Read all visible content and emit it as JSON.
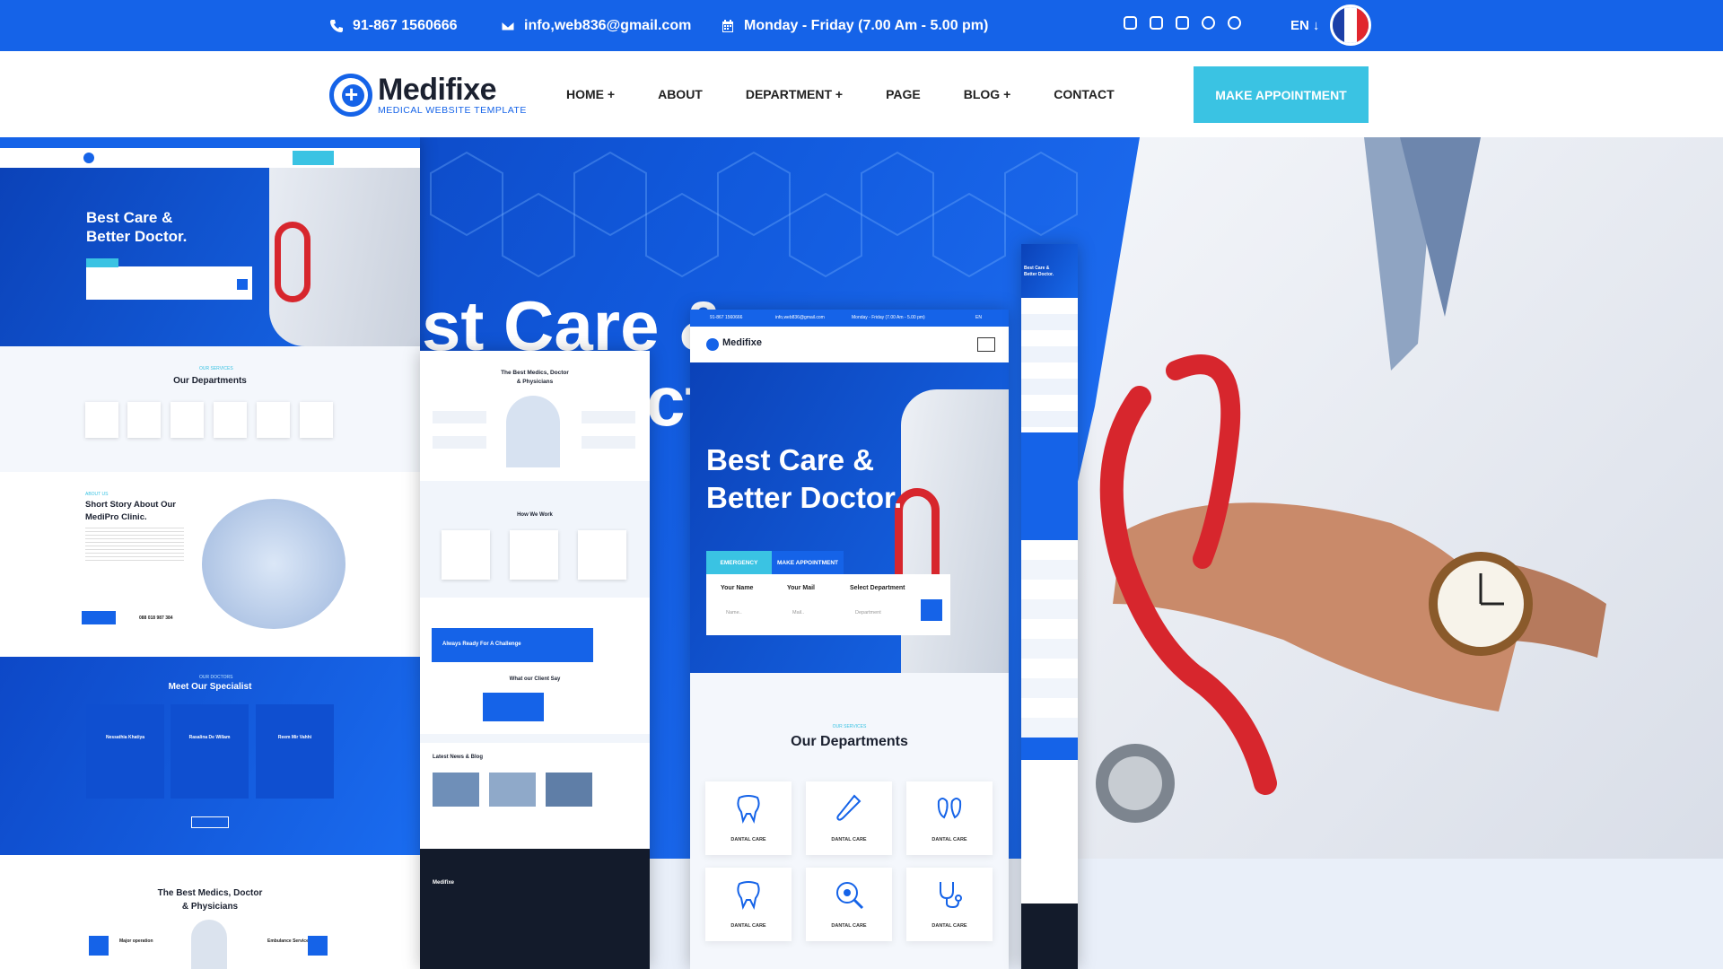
{
  "topbar": {
    "phone": "91-867 1560666",
    "email": "info,web836@gmail.com",
    "hours": "Monday - Friday (7.00 Am - 5.00 pm)",
    "social_icons": [
      "facebook-icon",
      "twitter-icon",
      "youtube-icon",
      "instagram-icon",
      "pinterest-icon"
    ],
    "language": "EN"
  },
  "brand": {
    "name": "Medifixe",
    "tagline": "MEDICAL WEBSITE TEMPLATE"
  },
  "nav": {
    "items": [
      "HOME +",
      "ABOUT",
      "DEPARTMENT +",
      "PAGE",
      "BLOG +",
      "CONTACT"
    ],
    "cta": "MAKE APPOINTMENT"
  },
  "hero": {
    "big_text_line1": "st Care &",
    "big_text_line2": "ct"
  },
  "mock_left": {
    "hero_title_1": "Best Care &",
    "hero_title_2": "Better Doctor.",
    "sub_label": "OUR SERVICES",
    "departments_title": "Our Departments",
    "about_label": "ABOUT US",
    "about_title_1": "Short Story About Our",
    "about_title_2": "MediPro Clinic.",
    "phone": "088 018 987 384",
    "specialist_label": "OUR DOCTORS",
    "specialist_title": "Meet Our Specialist",
    "doctors": [
      "Nessathia Khatiya",
      "Rasalina De Willam",
      "Reem Mir Vahhi"
    ],
    "medics_title_1": "The Best Medics, Doctor",
    "medics_title_2": "& Physicians",
    "medics_service_1": "Major operation",
    "medics_service_2": "Embulance Service"
  },
  "mock_mid": {
    "medics_title_1": "The Best Medics, Doctor",
    "medics_title_2": "& Physicians",
    "how_title": "How We Work",
    "banner": "Always Ready For A Challenge",
    "client_title": "What our Client Say",
    "news_title": "Latest News & Blog",
    "footer_brand": "Medifixe"
  },
  "mock_center": {
    "phone": "91-867 1560666",
    "email": "info,web836@gmail.com",
    "hours": "Monday - Friday (7.00 Am - 5.00 pm)",
    "lang": "EN",
    "brand": "Medifixe",
    "hero_title_1": "Best Care &",
    "hero_title_2": "Better Doctor.",
    "tab_emergency": "EMERGENCY",
    "tab_appointment": "MAKE APPOINTMENT",
    "form_name": "Your Name",
    "form_mail": "Your Mail",
    "form_dept": "Select Department",
    "ph_name": "Name..",
    "ph_mail": "Mail..",
    "ph_dept": "Department",
    "services_label": "OUR SERVICES",
    "departments_title": "Our Departments",
    "departments": [
      "DANTAL CARE",
      "DANTAL CARE",
      "DANTAL CARE",
      "DANTAL CARE",
      "DANTAL CARE",
      "DANTAL CARE"
    ]
  },
  "mock_strip": {
    "hero_title": "Best Care & Better Doctor."
  },
  "colors": {
    "primary": "#1563e8",
    "accent": "#3ac3e3",
    "dark": "#1b2130"
  }
}
